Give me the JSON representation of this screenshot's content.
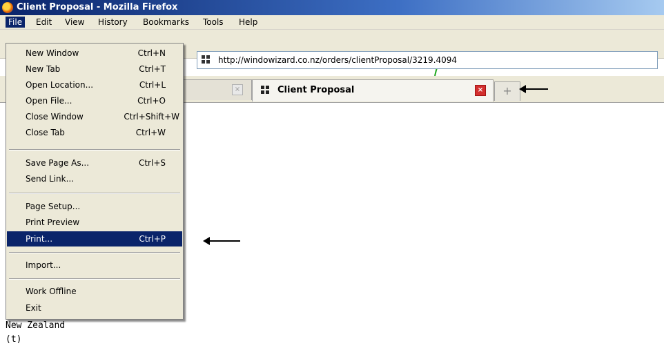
{
  "window": {
    "title": "Client Proposal - Mozilla Firefox"
  },
  "menubar": {
    "items": [
      {
        "label": "File",
        "active": true
      },
      {
        "label": "Edit"
      },
      {
        "label": "View"
      },
      {
        "label": "History"
      },
      {
        "label": "Bookmarks"
      },
      {
        "label": "Tools"
      },
      {
        "label": "Help"
      }
    ]
  },
  "navigation": {
    "url": "http://windowizard.co.nz/orders/clientProposal/3219.4094"
  },
  "tabs": {
    "active_label": "Client Proposal",
    "new_tab_symbol": "+"
  },
  "file_menu": {
    "items": [
      {
        "label": "New Window",
        "shortcut": "Ctrl+N"
      },
      {
        "label": "New Tab",
        "shortcut": "Ctrl+T"
      },
      {
        "label": "Open Location...",
        "shortcut": "Ctrl+L"
      },
      {
        "label": "Open File...",
        "shortcut": "Ctrl+O"
      },
      {
        "label": "Close Window",
        "shortcut": "Ctrl+Shift+W"
      },
      {
        "label": "Close Tab",
        "shortcut": "Ctrl+W"
      },
      {
        "label": "Save Page As...",
        "shortcut": "Ctrl+S"
      },
      {
        "label": "Send Link...",
        "shortcut": ""
      },
      {
        "label": "Page Setup...",
        "shortcut": ""
      },
      {
        "label": "Print Preview",
        "shortcut": ""
      },
      {
        "label": "Print...",
        "shortcut": "Ctrl+P",
        "highlighted": true
      },
      {
        "label": "Import...",
        "shortcut": ""
      },
      {
        "label": "Work Offline",
        "shortcut": ""
      },
      {
        "label": "Exit",
        "shortcut": ""
      }
    ]
  },
  "page_content": {
    "line1": "New Zealand",
    "line2": "(t)"
  },
  "colors": {
    "menu_highlight": "#0a246a",
    "menu_bg": "#ece9d8",
    "accent_green": "#22aa22"
  },
  "icons": [
    "firefox-icon",
    "site-icon",
    "close-icon",
    "new-tab-icon",
    "arrow-icon"
  ]
}
